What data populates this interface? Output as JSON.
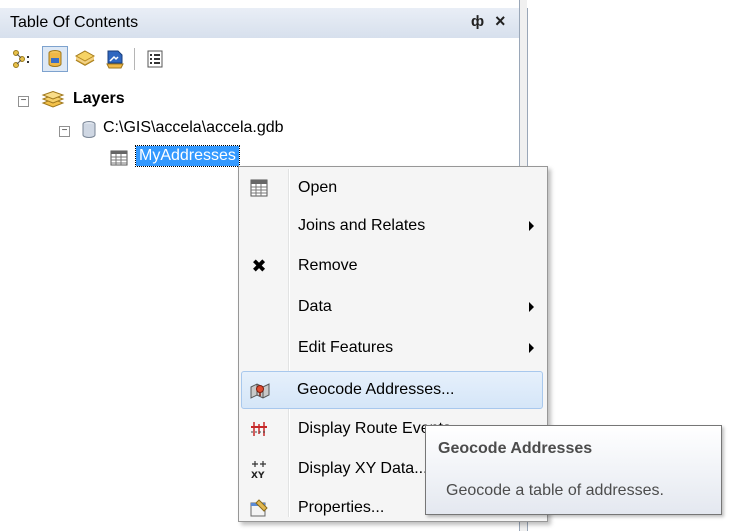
{
  "toc": {
    "title": "Table Of Contents",
    "pin_glyph": "ф",
    "close_glyph": "×",
    "toolbar": {
      "buttons": [
        "list-by-drawing-order-icon",
        "list-by-source-icon",
        "list-by-visibility-icon",
        "list-by-selection-icon",
        "options-icon"
      ]
    },
    "tree": {
      "root_label": "Layers",
      "source_label": "C:\\GIS\\accela\\accela.gdb",
      "table_label": "MyAddresses",
      "expander_glyph": "−"
    }
  },
  "context_menu": {
    "items": [
      {
        "label": "Open",
        "icon": "table-icon",
        "submenu": false
      },
      {
        "label": "Joins and Relates",
        "icon": "",
        "submenu": true
      },
      {
        "label": "Remove",
        "icon": "remove-icon",
        "submenu": false
      },
      {
        "label": "Data",
        "icon": "",
        "submenu": true
      },
      {
        "label": "Edit Features",
        "icon": "",
        "submenu": true
      },
      {
        "label": "Geocode Addresses...",
        "icon": "geocode-icon",
        "submenu": false,
        "highlighted": true
      },
      {
        "label": "Display Route Events...",
        "icon": "route-events-icon",
        "submenu": false
      },
      {
        "label": "Display XY Data...",
        "icon": "xy-data-icon",
        "submenu": false
      },
      {
        "label": "Properties...",
        "icon": "properties-icon",
        "submenu": false
      }
    ],
    "remove_glyph": "✖"
  },
  "tooltip": {
    "title": "Geocode Addresses",
    "description": "Geocode a table of addresses."
  }
}
